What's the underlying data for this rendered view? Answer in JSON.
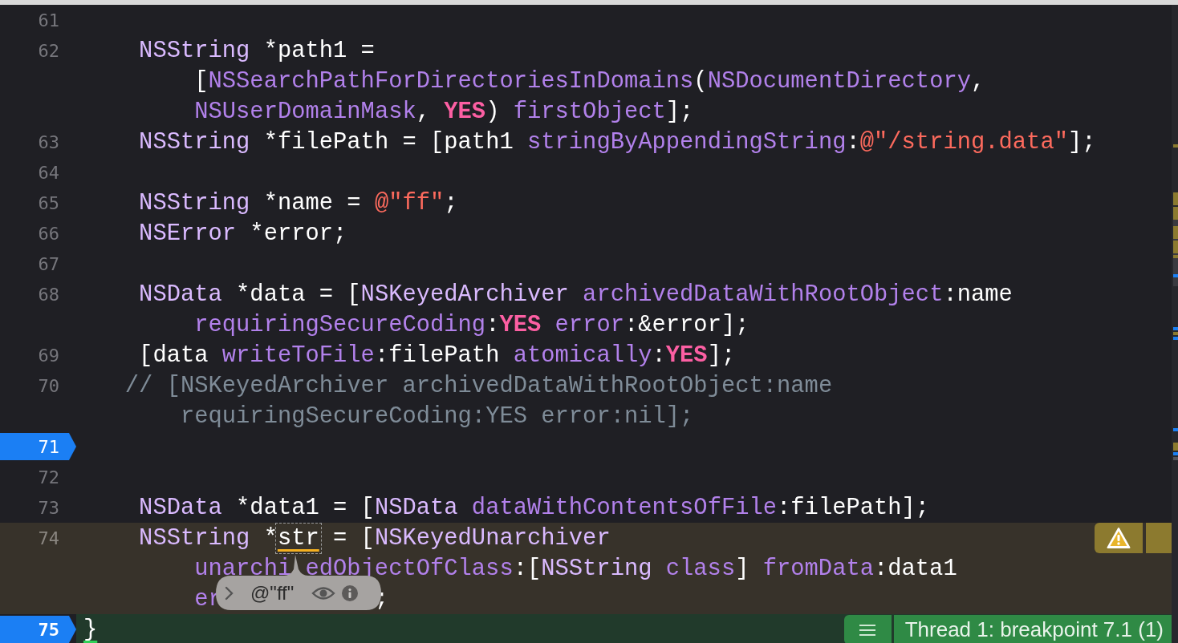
{
  "lines": [
    {
      "number": "61",
      "breakpoint": false,
      "warning": false,
      "current": false
    },
    {
      "number": "62",
      "breakpoint": false,
      "warning": false,
      "current": false,
      "rows": [
        {
          "kind": "code",
          "tokens": [
            {
              "t": "NSString",
              "kind": "type"
            },
            {
              "t": " *path1 =",
              "kind": "plain"
            }
          ]
        },
        {
          "kind": "wrap",
          "tokens": [
            {
              "t": "[",
              "kind": "plain"
            },
            {
              "t": "NSSearchPathForDirectoriesInDomains",
              "kind": "method"
            },
            {
              "t": "(",
              "kind": "plain"
            },
            {
              "t": "NSDocumentDirectory",
              "kind": "method"
            },
            {
              "t": ",",
              "kind": "plain"
            }
          ]
        },
        {
          "kind": "wrap",
          "tokens": [
            {
              "t": "NSUserDomainMask",
              "kind": "method"
            },
            {
              "t": ", ",
              "kind": "plain"
            },
            {
              "t": "YES",
              "kind": "keyword"
            },
            {
              "t": ") ",
              "kind": "plain"
            },
            {
              "t": "firstObject",
              "kind": "method"
            },
            {
              "t": "];",
              "kind": "plain"
            }
          ]
        }
      ]
    },
    {
      "number": "63",
      "breakpoint": false,
      "warning": false,
      "current": false,
      "rows": [
        {
          "kind": "code",
          "tokens": [
            {
              "t": "NSString",
              "kind": "type"
            },
            {
              "t": " *filePath = [path1 ",
              "kind": "plain"
            },
            {
              "t": "stringByAppendingString",
              "kind": "method"
            },
            {
              "t": ":",
              "kind": "plain"
            },
            {
              "t": "@\"/string.data\"",
              "kind": "string"
            },
            {
              "t": "];",
              "kind": "plain"
            }
          ]
        }
      ]
    },
    {
      "number": "64",
      "breakpoint": false,
      "warning": false,
      "current": false
    },
    {
      "number": "65",
      "breakpoint": false,
      "warning": false,
      "current": false,
      "rows": [
        {
          "kind": "code",
          "tokens": [
            {
              "t": "NSString",
              "kind": "type"
            },
            {
              "t": " *name = ",
              "kind": "plain"
            },
            {
              "t": "@\"ff\"",
              "kind": "string"
            },
            {
              "t": ";",
              "kind": "plain"
            }
          ]
        }
      ]
    },
    {
      "number": "66",
      "breakpoint": false,
      "warning": false,
      "current": false,
      "rows": [
        {
          "kind": "code",
          "tokens": [
            {
              "t": "NSError",
              "kind": "type"
            },
            {
              "t": " *error;",
              "kind": "plain"
            }
          ]
        }
      ]
    },
    {
      "number": "67",
      "breakpoint": false,
      "warning": false,
      "current": false
    },
    {
      "number": "68",
      "breakpoint": false,
      "warning": false,
      "current": false,
      "rows": [
        {
          "kind": "code",
          "tokens": [
            {
              "t": "NSData",
              "kind": "type"
            },
            {
              "t": " *data = [",
              "kind": "plain"
            },
            {
              "t": "NSKeyedArchiver",
              "kind": "type"
            },
            {
              "t": " archivedDataWithRootObject",
              "kind": "method"
            },
            {
              "t": ":name",
              "kind": "plain"
            }
          ]
        },
        {
          "kind": "wrap",
          "tokens": [
            {
              "t": "requiringSecureCoding",
              "kind": "method"
            },
            {
              "t": ":",
              "kind": "plain"
            },
            {
              "t": "YES",
              "kind": "keyword"
            },
            {
              "t": " error",
              "kind": "method"
            },
            {
              "t": ":&error];",
              "kind": "plain"
            }
          ]
        }
      ]
    },
    {
      "number": "69",
      "breakpoint": false,
      "warning": false,
      "current": false,
      "rows": [
        {
          "kind": "code",
          "tokens": [
            {
              "t": "[data ",
              "kind": "plain"
            },
            {
              "t": "writeToFile",
              "kind": "method"
            },
            {
              "t": ":filePath ",
              "kind": "plain"
            },
            {
              "t": "atomically",
              "kind": "method"
            },
            {
              "t": ":",
              "kind": "plain"
            },
            {
              "t": "YES",
              "kind": "keyword"
            },
            {
              "t": "];",
              "kind": "plain"
            }
          ]
        }
      ]
    },
    {
      "number": "70",
      "breakpoint": false,
      "warning": false,
      "current": false,
      "rows": [
        {
          "kind": "comment",
          "tokens": [
            {
              "t": "// [NSKeyedArchiver archivedDataWithRootObject:name",
              "kind": "comment"
            }
          ]
        },
        {
          "kind": "comment_wrap",
          "tokens": [
            {
              "t": "requiringSecureCoding:YES error:nil];",
              "kind": "comment"
            }
          ]
        }
      ]
    },
    {
      "number": "71",
      "breakpoint": true,
      "warning": false,
      "current": false
    },
    {
      "number": "72",
      "breakpoint": false,
      "warning": false,
      "current": false
    },
    {
      "number": "73",
      "breakpoint": false,
      "warning": false,
      "current": false,
      "rows": [
        {
          "kind": "code",
          "tokens": [
            {
              "t": "NSData",
              "kind": "type"
            },
            {
              "t": " *data1 = [",
              "kind": "plain"
            },
            {
              "t": "NSData",
              "kind": "type"
            },
            {
              "t": " dataWithContentsOfFile",
              "kind": "method"
            },
            {
              "t": ":filePath];",
              "kind": "plain"
            }
          ]
        }
      ]
    },
    {
      "number": "74",
      "breakpoint": false,
      "warning": true,
      "current": false,
      "rows": [
        {
          "kind": "code",
          "tokens": [
            {
              "t": "NSString",
              "kind": "type"
            },
            {
              "t": " *",
              "kind": "plain"
            },
            {
              "t": "str",
              "kind": "inspected"
            },
            {
              "t": " = [",
              "kind": "plain"
            },
            {
              "t": "NSKeyedUnarchiver",
              "kind": "type"
            }
          ]
        },
        {
          "kind": "wrap",
          "tokens": [
            {
              "t": "unarchi",
              "kind": "method"
            },
            {
              "t": "edObjectOfClass",
              "kind": "method",
              "narrow_gap": true
            },
            {
              "t": ":[",
              "kind": "plain"
            },
            {
              "t": "NSString",
              "kind": "type"
            },
            {
              "t": " class",
              "kind": "method"
            },
            {
              "t": "] ",
              "kind": "plain"
            },
            {
              "t": "fromData",
              "kind": "method"
            },
            {
              "t": ":data1",
              "kind": "plain"
            }
          ]
        },
        {
          "kind": "wrap",
          "tokens": [
            {
              "t": "er",
              "kind": "method"
            },
            {
              "t": ";",
              "kind": "plain",
              "wide_gap": true
            }
          ]
        }
      ]
    },
    {
      "number": "75",
      "breakpoint": true,
      "warning": false,
      "current": true,
      "thread_badge": "Thread 1: breakpoint 7.1 (1)",
      "rows": [
        {
          "kind": "none",
          "tokens": [
            {
              "t": "}",
              "kind": "brace"
            }
          ]
        }
      ]
    }
  ],
  "popover": {
    "value": "@\"ff\""
  }
}
